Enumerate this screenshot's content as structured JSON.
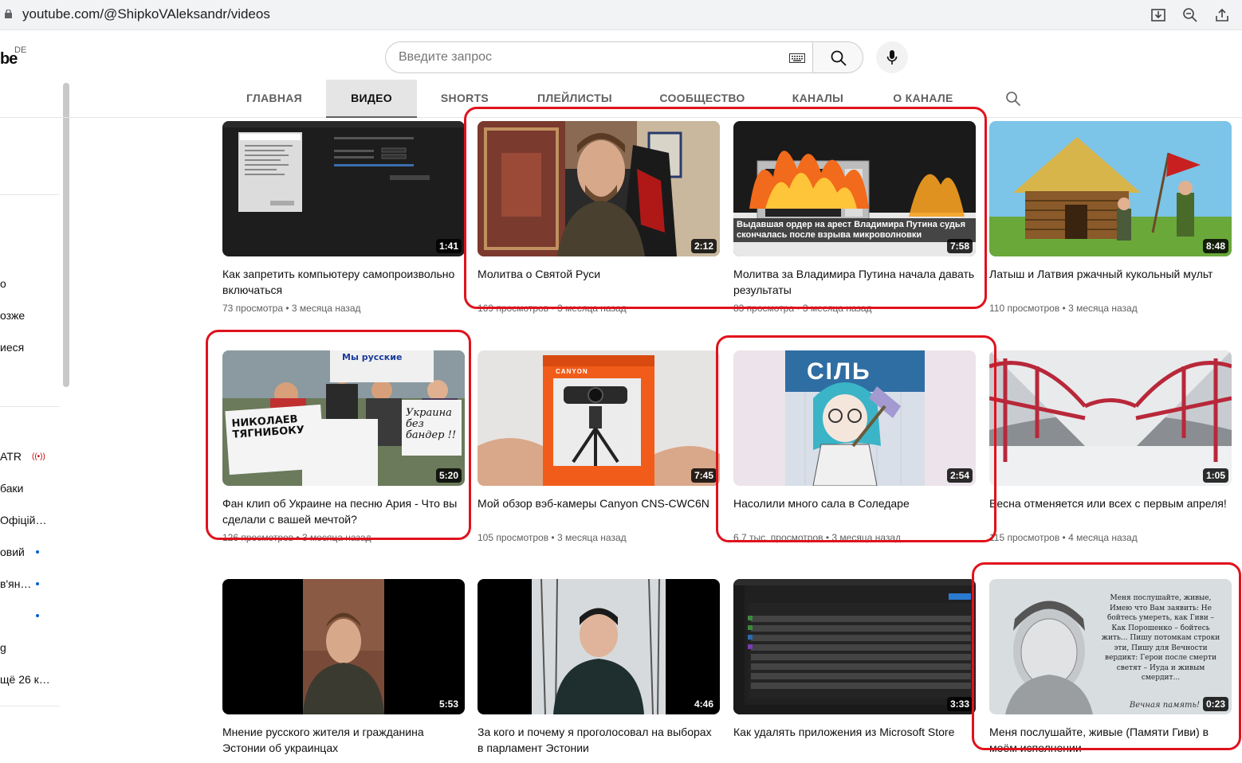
{
  "browser": {
    "url": "youtube.com/@ShipkoVAleksandr/videos"
  },
  "logo": {
    "text": "be",
    "region": "DE"
  },
  "sidebar": {
    "items": [
      {
        "label": "о"
      },
      {
        "label": "озже"
      },
      {
        "label": "иеся"
      },
      {
        "label": "ATR"
      },
      {
        "label": "баки"
      },
      {
        "label": "Офіцій…"
      },
      {
        "label": "овий"
      },
      {
        "label": "в'ян…"
      },
      {
        "label": "g"
      },
      {
        "label": "щё 26 к…"
      }
    ]
  },
  "search": {
    "placeholder": "Введите запрос"
  },
  "tabs": [
    {
      "label": "ГЛАВНАЯ"
    },
    {
      "label": "ВИДЕО"
    },
    {
      "label": "SHORTS"
    },
    {
      "label": "ПЛЕЙЛИСТЫ"
    },
    {
      "label": "СООБЩЕСТВО"
    },
    {
      "label": "КАНАЛЫ"
    },
    {
      "label": "О КАНАЛЕ"
    }
  ],
  "videos": [
    {
      "title": "Как запретить компьютеру самопроизвольно включаться",
      "views": "73 просмотра",
      "age": "3 месяца назад",
      "duration": "1:41"
    },
    {
      "title": "Молитва о Святой Руси",
      "views": "169 просмотров",
      "age": "3 месяца назад",
      "duration": "2:12"
    },
    {
      "title": "Молитва за Владимира Путина начала давать результаты",
      "views": "83 просмотра",
      "age": "3 месяца назад",
      "duration": "7:58",
      "overlay": "Выдавшая ордер на арест Владимира Путина судья скончалась после взрыва микроволновки"
    },
    {
      "title": "Латыш и Латвия ржачный кукольный мульт",
      "views": "110 просмотров",
      "age": "3 месяца назад",
      "duration": "8:48"
    },
    {
      "title": "Фан клип об Украине на песню Ария - Что вы сделали с вашей мечтой?",
      "views": "126 просмотров",
      "age": "3 месяца назад",
      "duration": "5:20",
      "sign1": "НИКОЛАЕВ ТЯГНИБОКУ",
      "sign2": "Украина без бандер !!",
      "sign3": "Мы русские"
    },
    {
      "title": "Мой обзор вэб-камеры Canyon CNS-CWC6N",
      "views": "105 просмотров",
      "age": "3 месяца назад",
      "duration": "7:45",
      "brand": "CANYON"
    },
    {
      "title": "Насолили много сала в Соледаре",
      "views": "6,7 тыс. просмотров",
      "age": "3 месяца назад",
      "duration": "2:54",
      "poster": "СІЛЬ"
    },
    {
      "title": "Весна отменяется или всех с первым апреля!",
      "views": "115 просмотров",
      "age": "4 месяца назад",
      "duration": "1:05"
    },
    {
      "title": "Мнение русского жителя и гражданина Эстонии об украинцах",
      "views": "",
      "age": "",
      "duration": "5:53"
    },
    {
      "title": "За кого и почему я проголосовал на выборах в парламент Эстонии",
      "views": "",
      "age": "",
      "duration": "4:46"
    },
    {
      "title": "Как удалять приложения из Microsoft Store",
      "views": "",
      "age": "",
      "duration": "3:33"
    },
    {
      "title": "Меня послушайте, живые (Памяти Гиви) в моём исполнении",
      "views": "",
      "age": "",
      "duration": "0:23",
      "quote": "Меня послушайте, живые, Имею что Вам заявить: Не бойтесь умереть, как Гиви – Как Порошенко – бойтесь жить... Пишу потомкам строки эти, Пишу для Вечности вердикт: Герои после смерти светят – Иуда и живым смердит...",
      "signature": "Вечная память!"
    }
  ],
  "colors": {
    "highlight": "#e0121c",
    "live": "#cc0000",
    "accent": "#065fd4"
  }
}
